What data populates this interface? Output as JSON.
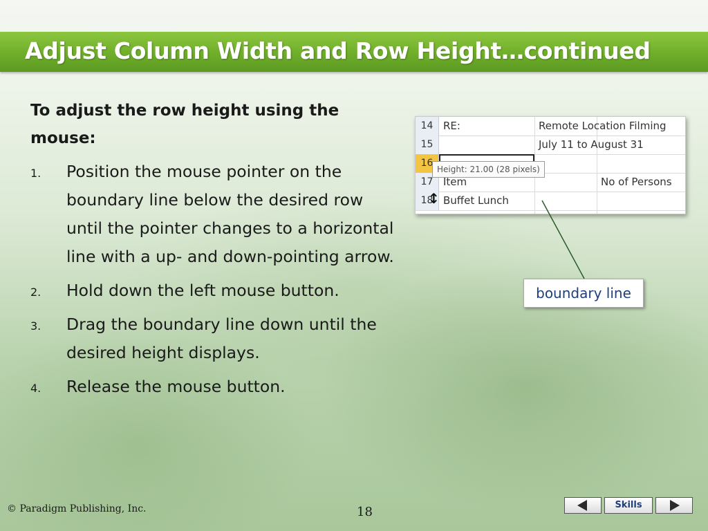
{
  "slide": {
    "title": "Adjust Column Width and Row Height…continued",
    "subhead": "To adjust the row height using the mouse:",
    "steps": [
      {
        "num": "1.",
        "text": "Position the mouse pointer on the boundary line below the desired row until the pointer changes to a horizontal line with a up- and down-pointing arrow."
      },
      {
        "num": "2.",
        "text": "Hold down the left mouse button."
      },
      {
        "num": "3.",
        "text": "Drag the boundary line down until the desired height displays."
      },
      {
        "num": "4.",
        "text": "Release the mouse button."
      }
    ],
    "callout": "boundary line"
  },
  "screenshot": {
    "rows": [
      {
        "num": "14",
        "a": "RE:",
        "b": "Remote Location Filming"
      },
      {
        "num": "15",
        "a": "",
        "b": "July 11 to August 31"
      },
      {
        "num": "16",
        "a": "",
        "b": ""
      },
      {
        "num": "17",
        "a": "Item",
        "b": "No of Persons"
      },
      {
        "num": "18",
        "a": "Buffet Lunch",
        "b": ""
      }
    ],
    "tooltip": "Height: 21.00 (28 pixels)"
  },
  "footer": {
    "copyright": "© Paradigm Publishing, Inc.",
    "page": "18",
    "skills": "Skills"
  },
  "colors": {
    "title_bar": "#6fae2a",
    "callout_text": "#1f3f7a"
  }
}
